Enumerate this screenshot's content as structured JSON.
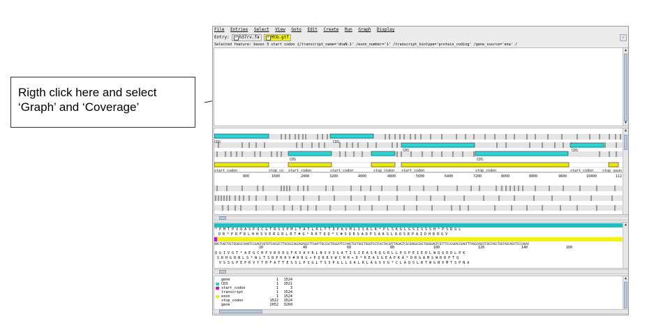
{
  "callout": {
    "line1": "Rigth click here and select",
    "line2": "‘Graph’ and ‘Coverage’"
  },
  "menubar": [
    "File",
    "Entries",
    "Select",
    "View",
    "Goto",
    "Edit",
    "Create",
    "Run",
    "Graph",
    "Display"
  ],
  "entry": {
    "label": "Entry:",
    "items": [
      {
        "name": "h37rv.fa",
        "checked": true,
        "active": false
      },
      {
        "name": "Mtb.gtf",
        "checked": true,
        "active": true
      }
    ]
  },
  "selected_feature": "Selected feature:  bases 3  start codon  {/transcript_name='dnaN-1' /exon_number='1' /transcript_biotype='protein_coding' /gene_source='ena' /",
  "feature_view": {
    "cds_labels": [
      "CDS",
      "CDS",
      "CDS",
      "CDS",
      "CDS",
      "CDS"
    ],
    "feature_labels": [
      "start_codon",
      "stop_co",
      "start_codon",
      "start_codon",
      "stop_codon",
      "start_codon",
      "stop_codon",
      "start_codon",
      "stop",
      "exon"
    ],
    "ruler": [
      "800",
      "1600",
      "2400",
      "3200",
      "4000",
      "4800",
      "5600",
      "6400",
      "7200",
      "8000",
      "8800",
      "9600",
      "10400",
      "112"
    ]
  },
  "sequence_view": {
    "aa_top": "* P M T P V Q A S P Q C G T R S S P M L T A T L R L T T D P A V M L I S A L R * P L S K G L G S I S S S H * P S R G L",
    "aa_mid": "D R * P R F R L H H S V E R G R L R T # G * R R T Q Q * C # S Q R S A D P S A K G L A Q S R P A I D H R R G V",
    "dna": "AACTGGCTACTGGGGCCAAGTCCGAGTGGTGTCACGCCTTGCGCCAGCAGAGGCTTGAATTGCCGCTGGGATTCCAACTGCTGGCTGGGTCGTCACTACGATTAGAGTCGCGAGGCGACTGGGGAGTCGTTTCCCGAACCGAGTTTAGGCAGGTCGGTAGCTGGTAGCAGCTCCCAAAC",
    "ruler": [
      "20",
      "40",
      "60",
      "80",
      "100",
      "120",
      "140",
      "160"
    ],
    "aa_r1": "Q G I V G T * A E G C H P V R D D G F K V A V R L N V V S G A T I S I E A S R Q G R L L P S P E I E D L W Q G D D L P K",
    "aa_r2": "S R H G R N L S * W L T S R P R R V # R R G + P Q R R V W C H H + D * R E A S G E A P K A * D R G A M S W R R P T Q",
    "aa_r3": "V S S G P E P K V Y T H F A T T E S S L P S G L T S S P G L L S A L R L A G S V G * C L A Q S L R T W G N V M T S P N A"
  },
  "legend": [
    {
      "name": "gene",
      "color": "",
      "start": "1",
      "end": "1524"
    },
    {
      "name": "CDS",
      "color": "#20d8d8",
      "start": "1",
      "end": "1521"
    },
    {
      "name": "start_codon",
      "color": "#e000e0",
      "start": "1",
      "end": "3"
    },
    {
      "name": "transcript",
      "color": "",
      "start": "1",
      "end": "1524"
    },
    {
      "name": "exon",
      "color": "#f0f000",
      "start": "1",
      "end": "1524"
    },
    {
      "name": "stop_codon",
      "color": "",
      "start": "1522",
      "end": "1524"
    },
    {
      "name": "gene",
      "color": "",
      "start": "2052",
      "end": "3260"
    }
  ],
  "colors": {
    "cds": "#20d8d8",
    "exon": "#f0e800",
    "start_codon": "#e000e0",
    "dna_row": "#f5f500",
    "aa_highlight": "#1ac0c8"
  }
}
